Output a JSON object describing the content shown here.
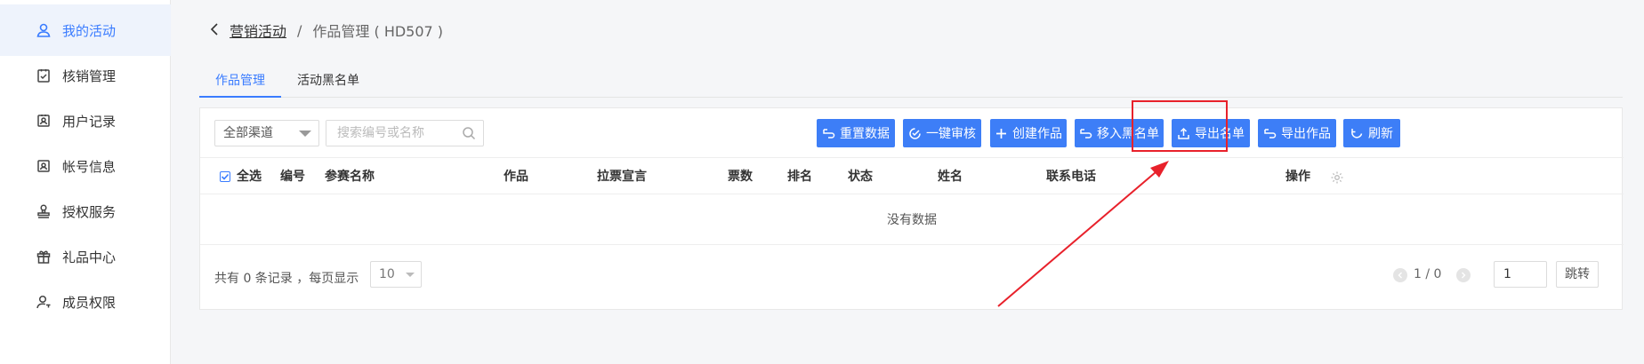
{
  "sidebar": {
    "items": [
      {
        "label": "我的活动",
        "icon": "user-icon",
        "active": true
      },
      {
        "label": "核销管理",
        "icon": "clipboard-check-icon",
        "active": false
      },
      {
        "label": "用户记录",
        "icon": "id-card-icon",
        "active": false
      },
      {
        "label": "帐号信息",
        "icon": "id-card-icon",
        "active": false
      },
      {
        "label": "授权服务",
        "icon": "stamp-icon",
        "active": false
      },
      {
        "label": "礼品中心",
        "icon": "gift-icon",
        "active": false
      },
      {
        "label": "成员权限",
        "icon": "user-key-icon",
        "active": false
      }
    ]
  },
  "breadcrumb": {
    "back_icon": "chevron-left-icon",
    "link": "营销活动",
    "separator": "/",
    "current": "作品管理 ( HD507 )"
  },
  "tabs": [
    {
      "label": "作品管理",
      "active": true
    },
    {
      "label": "活动黑名单",
      "active": false
    }
  ],
  "toolbar": {
    "channel_select": "全部渠道",
    "search_placeholder": "搜索编号或名称",
    "buttons": [
      {
        "label": "重置数据",
        "icon": "undo-icon"
      },
      {
        "label": "一键审核",
        "icon": "check-circle-icon"
      },
      {
        "label": "创建作品",
        "icon": "plus-icon"
      },
      {
        "label": "移入黑名单",
        "icon": "undo-icon"
      },
      {
        "label": "导出名单",
        "icon": "upload-icon"
      },
      {
        "label": "导出作品",
        "icon": "undo-icon"
      },
      {
        "label": "刷新",
        "icon": "refresh-icon"
      }
    ]
  },
  "table": {
    "select_all": "全选",
    "columns": [
      "编号",
      "参赛名称",
      "作品",
      "拉票宣言",
      "票数",
      "排名",
      "状态",
      "姓名",
      "联系电话",
      "操作"
    ],
    "empty_text": "没有数据"
  },
  "pagination": {
    "total_text": "共有 0 条记录 ，每页显示",
    "page_size": "10",
    "page_info": "1 / 0",
    "page_input": "1",
    "jump_label": "跳转"
  },
  "colors": {
    "primary": "#3d7ef7",
    "annotation": "#e8212b"
  }
}
